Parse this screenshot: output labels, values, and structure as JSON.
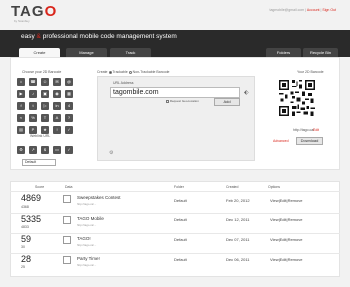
{
  "header": {
    "logo_text_a": "TAG",
    "logo_text_b": "O",
    "logo_sub": "by Scanbuy",
    "user": "tagmobile@gmail.com",
    "account_link": "Account",
    "signout_link": "Sign Out",
    "tagline_a": "easy",
    "tagline_amp": "&",
    "tagline_b": "professional mobile code management system"
  },
  "tabs": {
    "create": "Create",
    "manage": "Manage",
    "track": "Track",
    "folders": "Folders",
    "recycle": "Recycle Bin"
  },
  "left": {
    "choose_label": "Choose your 2D Barcode",
    "weblink_label": "Weblink URL",
    "default_select": "Default"
  },
  "form": {
    "create_label": "Create",
    "trackable": "Trackable",
    "non_trackable": "Non-Trackable Barcode",
    "url_label": "URL Address",
    "url_value": "tagombile.com",
    "checkbox_label": "Request Geo-location",
    "add_label": "Add"
  },
  "right": {
    "your_id": "Your 2D Barcode",
    "tag_url": "http://tago.ca/",
    "edit": "Edit",
    "advanced": "Advanced",
    "download": "Download"
  },
  "table": {
    "headers": [
      "Score",
      "Data",
      "Folder",
      "Created",
      "Options"
    ],
    "rows": [
      {
        "score": "4869",
        "sub": "4368",
        "title": "Sweepstakes Contest",
        "url": "http://tago.ca/...",
        "folder": "Default",
        "created": "Feb 20, 2012",
        "options": "View|Edit|Remove"
      },
      {
        "score": "5335",
        "sub": "4833",
        "title": "TAGO Mobile",
        "url": "http://tago.ca/...",
        "folder": "Default",
        "created": "Dec 12, 2011",
        "options": "View|Edit|Remove"
      },
      {
        "score": "59",
        "sub": "30",
        "title": "TAGO!",
        "url": "http://tago.ca/...",
        "folder": "Default",
        "created": "Dec 07, 2011",
        "options": "View|Edit|Remove"
      },
      {
        "score": "28",
        "sub": "25",
        "title": "Party Time!",
        "url": "http://tago.ca/...",
        "folder": "Default",
        "created": "Dec 06, 2011",
        "options": "View|Edit|Remove"
      }
    ]
  },
  "colors": {
    "accent": "#d9261c",
    "header_bg": "#2a2a2a"
  }
}
